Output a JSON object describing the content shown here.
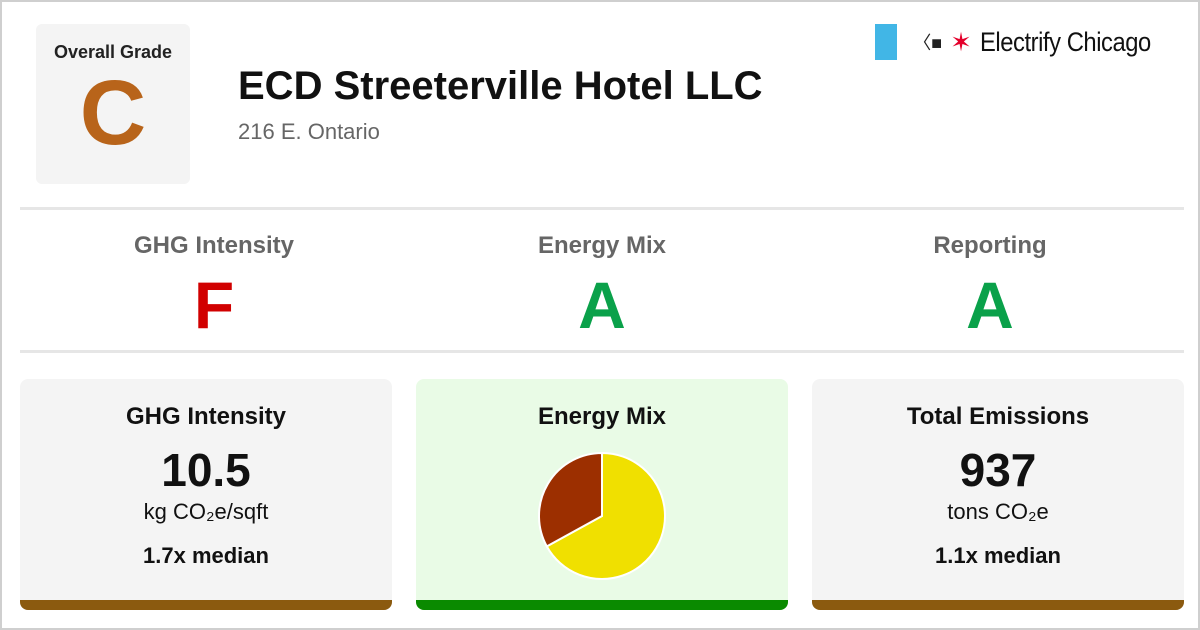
{
  "overall": {
    "label": "Overall Grade",
    "grade": "C",
    "grade_color": "#b8641a"
  },
  "building": {
    "name": "ECD Streeterville Hotel LLC",
    "address": "216 E. Ontario"
  },
  "brand": {
    "name": "Electrify Chicago",
    "logo_icon": "chicago-flag-icon",
    "plug_icon": "plug-icon",
    "star_icon": "star-icon"
  },
  "grades": [
    {
      "label": "GHG Intensity",
      "grade": "F",
      "color": "#d10000"
    },
    {
      "label": "Energy Mix",
      "grade": "A",
      "color": "#0aa14a"
    },
    {
      "label": "Reporting",
      "grade": "A",
      "color": "#0aa14a"
    }
  ],
  "cards": {
    "ghg": {
      "title": "GHG Intensity",
      "value": "10.5",
      "unit": "kg CO₂e/sqft",
      "median": "1.7x median",
      "bar_color": "#8b5a0f"
    },
    "mix": {
      "title": "Energy Mix",
      "bar_color": "#0a8a00"
    },
    "total": {
      "title": "Total Emissions",
      "value": "937",
      "unit": "tons CO₂e",
      "median": "1.1x median",
      "bar_color": "#8b5a0f"
    }
  },
  "chart_data": {
    "type": "pie",
    "values": [
      67,
      33
    ],
    "colors": [
      "#f0e000",
      "#9c2f00"
    ]
  }
}
